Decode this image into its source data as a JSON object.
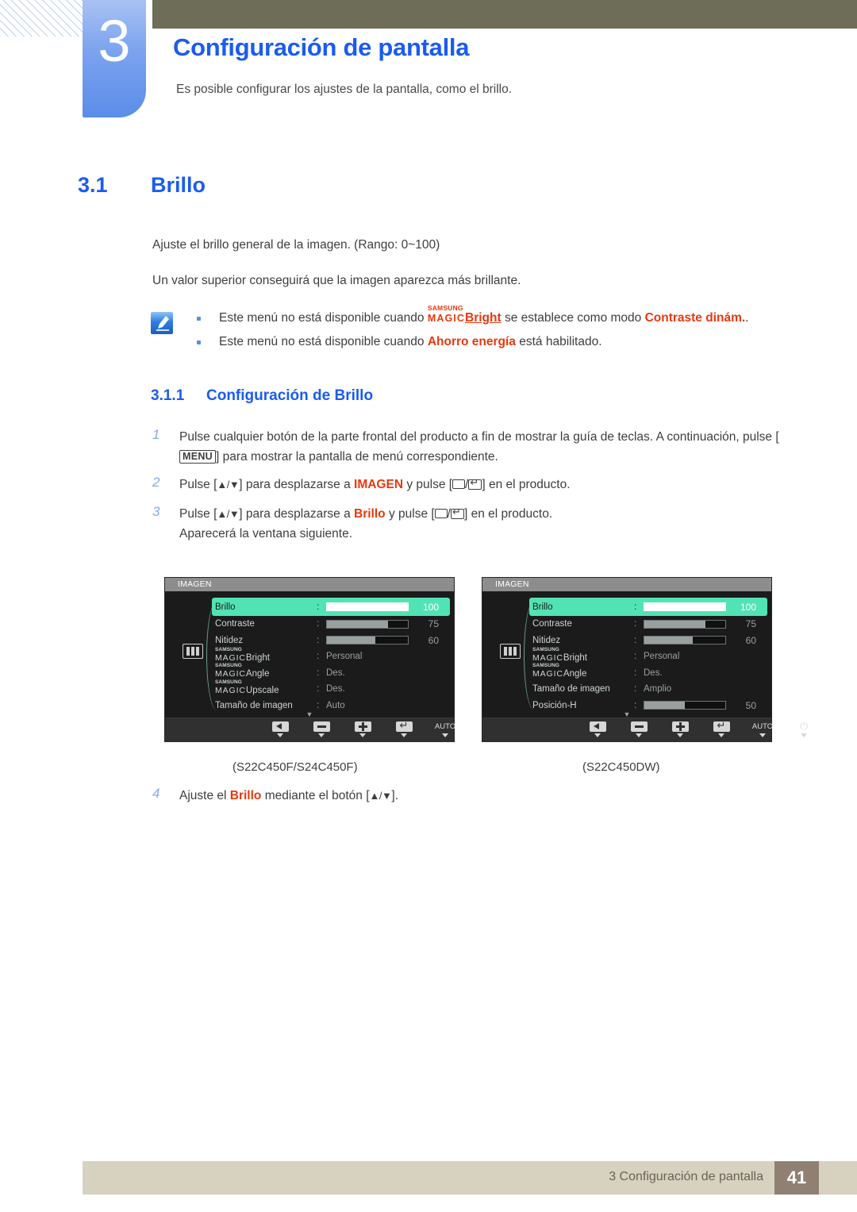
{
  "chapter": {
    "number": "3",
    "title": "Configuración de pantalla",
    "description": "Es posible configurar los ajustes de la pantalla, como el brillo."
  },
  "section": {
    "number": "3.1",
    "title": "Brillo",
    "paragraphs": [
      "Ajuste el brillo general de la imagen. (Rango: 0~100)",
      "Un valor superior conseguirá que la imagen aparezca más brillante."
    ]
  },
  "note": {
    "icon": "note-pen-icon",
    "items": [
      {
        "pre": "Este menú no está disponible cuando ",
        "magic_sup": "SAMSUNG",
        "magic_main": "MAGIC",
        "magic_suffix": "Bright",
        "mid": " se establece como modo ",
        "highlight": "Contraste dinám.",
        "post": "."
      },
      {
        "pre": "Este menú no está disponible cuando ",
        "highlight": "Ahorro energía",
        "post": " está habilitado."
      }
    ]
  },
  "subsection": {
    "number": "3.1.1",
    "title": "Configuración de Brillo"
  },
  "steps": [
    {
      "num": "1",
      "text_a": "Pulse cualquier botón de la parte frontal del producto a fin de mostrar la guía de teclas. A continuación, pulse [",
      "key": "MENU",
      "text_b": "] para mostrar la pantalla de menú correspondiente."
    },
    {
      "num": "2",
      "text_a": "Pulse [",
      "arrows": "▲/▼",
      "text_b": "] para desplazarse a ",
      "highlight": "IMAGEN",
      "text_c": " y pulse [",
      "text_d": "] en el producto."
    },
    {
      "num": "3",
      "text_a": "Pulse [",
      "arrows": "▲/▼",
      "text_b": "] para desplazarse a ",
      "highlight": "Brillo",
      "text_c": " y pulse [",
      "text_d": "] en el producto.",
      "extra": "Aparecerá la ventana siguiente."
    },
    {
      "num": "4",
      "text_a": "Ajuste el ",
      "highlight": "Brillo",
      "text_b": " mediante el botón [",
      "arrows": "▲/▼",
      "text_c": "]."
    }
  ],
  "osd": {
    "title": "IMAGEN",
    "category_icon": "picture-bars-icon",
    "more_indicator": "▼",
    "buttons": [
      {
        "name": "back-button",
        "glyph": "left-arrow",
        "label": ""
      },
      {
        "name": "minus-button",
        "glyph": "minus",
        "label": ""
      },
      {
        "name": "plus-button",
        "glyph": "plus",
        "label": ""
      },
      {
        "name": "enter-button",
        "glyph": "enter",
        "label": ""
      },
      {
        "name": "auto-button",
        "glyph": "text",
        "label": "AUTO"
      },
      {
        "name": "power-button",
        "glyph": "power",
        "label": "⏻"
      }
    ],
    "left": {
      "caption": "(S22C450F/S24C450F)",
      "rows": [
        {
          "label": "Brillo",
          "type": "bar",
          "value": "100",
          "fill": 100,
          "selected": true
        },
        {
          "label": "Contraste",
          "type": "bar",
          "value": "75",
          "fill": 75,
          "selected": false
        },
        {
          "label": "Nitidez",
          "type": "bar",
          "value": "60",
          "fill": 60,
          "selected": false
        },
        {
          "label": "Bright",
          "type": "magic",
          "value": "Personal",
          "selected": false
        },
        {
          "label": "Angle",
          "type": "magic",
          "value": "Des.",
          "selected": false
        },
        {
          "label": "Upscale",
          "type": "magic",
          "value": "Des.",
          "selected": false
        },
        {
          "label": "Tamaño de imagen",
          "type": "text",
          "value": "Auto",
          "selected": false
        }
      ]
    },
    "right": {
      "caption": "(S22C450DW)",
      "rows": [
        {
          "label": "Brillo",
          "type": "bar",
          "value": "100",
          "fill": 100,
          "selected": true
        },
        {
          "label": "Contraste",
          "type": "bar",
          "value": "75",
          "fill": 75,
          "selected": false
        },
        {
          "label": "Nitidez",
          "type": "bar",
          "value": "60",
          "fill": 60,
          "selected": false
        },
        {
          "label": "Bright",
          "type": "magic",
          "value": "Personal",
          "selected": false
        },
        {
          "label": "Angle",
          "type": "magic",
          "value": "Des.",
          "selected": false
        },
        {
          "label": "Tamaño de imagen",
          "type": "text",
          "value": "Amplio",
          "selected": false
        },
        {
          "label": "Posición-H",
          "type": "bar",
          "value": "50",
          "fill": 50,
          "selected": false
        }
      ]
    },
    "magic_sup": "SAMSUNG",
    "magic_main": "MAGIC"
  },
  "footer": {
    "text": "3 Configuración de pantalla",
    "page": "41"
  },
  "colors": {
    "accent_blue": "#1a5cf0",
    "highlight_red": "#e8380d",
    "osd_selected_green": "#52e3b4",
    "header_olive": "#6e6d58",
    "footer_beige": "#d6d2bf",
    "footer_page_brown": "#8f8073"
  }
}
